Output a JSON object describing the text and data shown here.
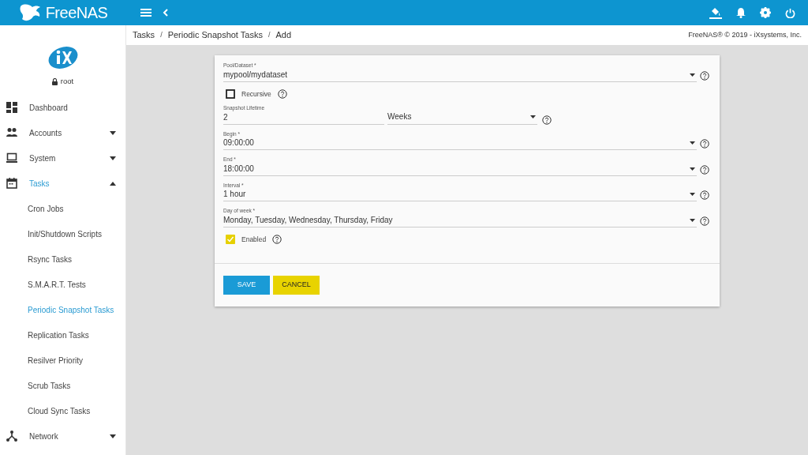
{
  "brand": {
    "name": "FreeNAS"
  },
  "sidebar": {
    "user": "root",
    "items": [
      {
        "label": "Dashboard",
        "selected": false
      },
      {
        "label": "Accounts",
        "selected": false,
        "expanded": false
      },
      {
        "label": "System",
        "selected": false,
        "expanded": false
      },
      {
        "label": "Tasks",
        "selected": true,
        "expanded": true,
        "children": [
          {
            "label": "Cron Jobs",
            "selected": false
          },
          {
            "label": "Init/Shutdown Scripts",
            "selected": false
          },
          {
            "label": "Rsync Tasks",
            "selected": false
          },
          {
            "label": "S.M.A.R.T. Tests",
            "selected": false
          },
          {
            "label": "Periodic Snapshot Tasks",
            "selected": true
          },
          {
            "label": "Replication Tasks",
            "selected": false
          },
          {
            "label": "Resilver Priority",
            "selected": false
          },
          {
            "label": "Scrub Tasks",
            "selected": false
          },
          {
            "label": "Cloud Sync Tasks",
            "selected": false
          }
        ]
      },
      {
        "label": "Network",
        "selected": false,
        "expanded": false
      }
    ]
  },
  "breadcrumb": [
    "Tasks",
    "Periodic Snapshot Tasks",
    "Add"
  ],
  "breadcrumb_separators": [
    "/",
    "/"
  ],
  "copyright": "FreeNAS® © 2019 - iXsystems, Inc.",
  "form": {
    "fields": [
      {
        "kind": "select",
        "label": "Pool/Dataset *",
        "value": "mypool/mydataset"
      },
      {
        "kind": "checkbox",
        "label": "Recursive",
        "checked": false
      },
      {
        "kind": "pair",
        "label": "Snapshot Lifetime",
        "value": "2",
        "unit": "Weeks"
      },
      {
        "kind": "select",
        "label": "Begin *",
        "value": "09:00:00"
      },
      {
        "kind": "select",
        "label": "End *",
        "value": "18:00:00"
      },
      {
        "kind": "select",
        "label": "Interval *",
        "value": "1 hour"
      },
      {
        "kind": "select",
        "label": "Day of week *",
        "value": "Monday, Tuesday, Wednesday, Thursday, Friday"
      },
      {
        "kind": "checkbox",
        "label": "Enabled",
        "checked": true
      }
    ],
    "buttons": [
      {
        "label": "SAVE",
        "kind": "primary"
      },
      {
        "label": "CANCEL",
        "kind": "warning"
      }
    ]
  }
}
